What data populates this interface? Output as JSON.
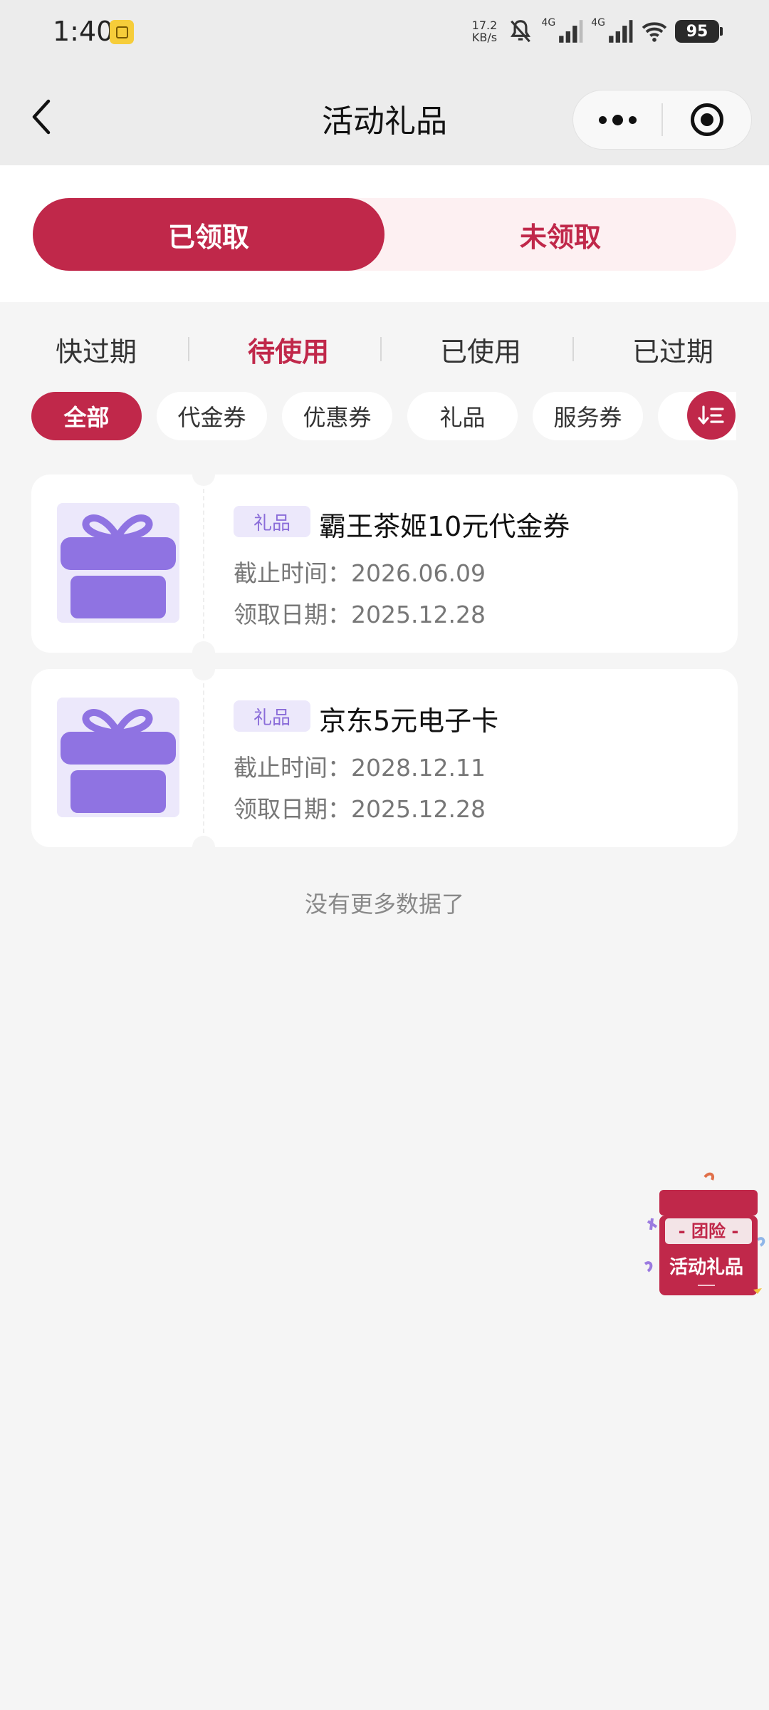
{
  "status_bar": {
    "time": "1:40",
    "net_speed_value": "17.2",
    "net_speed_unit": "KB/s",
    "signal1_label": "4G",
    "signal2_label": "4G",
    "battery": "95"
  },
  "nav": {
    "title": "活动礼品"
  },
  "segment": {
    "received": "已领取",
    "unreceived": "未领取"
  },
  "status_tabs": [
    "快过期",
    "待使用",
    "已使用",
    "已过期"
  ],
  "chips": [
    "全部",
    "代金券",
    "优惠券",
    "礼品",
    "服务券"
  ],
  "gifts": [
    {
      "tag": "礼品",
      "title": "霸王茶姬10元代金券",
      "deadline_label": "截止时间：",
      "deadline": "2026.06.09",
      "received_label": "领取日期：",
      "received": "2025.12.28"
    },
    {
      "tag": "礼品",
      "title": "京东5元电子卡",
      "deadline_label": "截止时间：",
      "deadline": "2028.12.11",
      "received_label": "领取日期：",
      "received": "2025.12.28"
    }
  ],
  "no_more": "没有更多数据了",
  "float_badge": {
    "line1": "- 团险 -",
    "line2": "活动礼品"
  },
  "colors": {
    "primary": "#c0284a",
    "primary_light": "#fdf0f2",
    "gift_purple": "#8f73e2",
    "gift_bg": "#ece8fb"
  },
  "icons": [
    "back-arrow-icon",
    "more-dots-icon",
    "target-icon",
    "sort-icon",
    "gift-icon",
    "mute-icon",
    "wifi-icon"
  ]
}
